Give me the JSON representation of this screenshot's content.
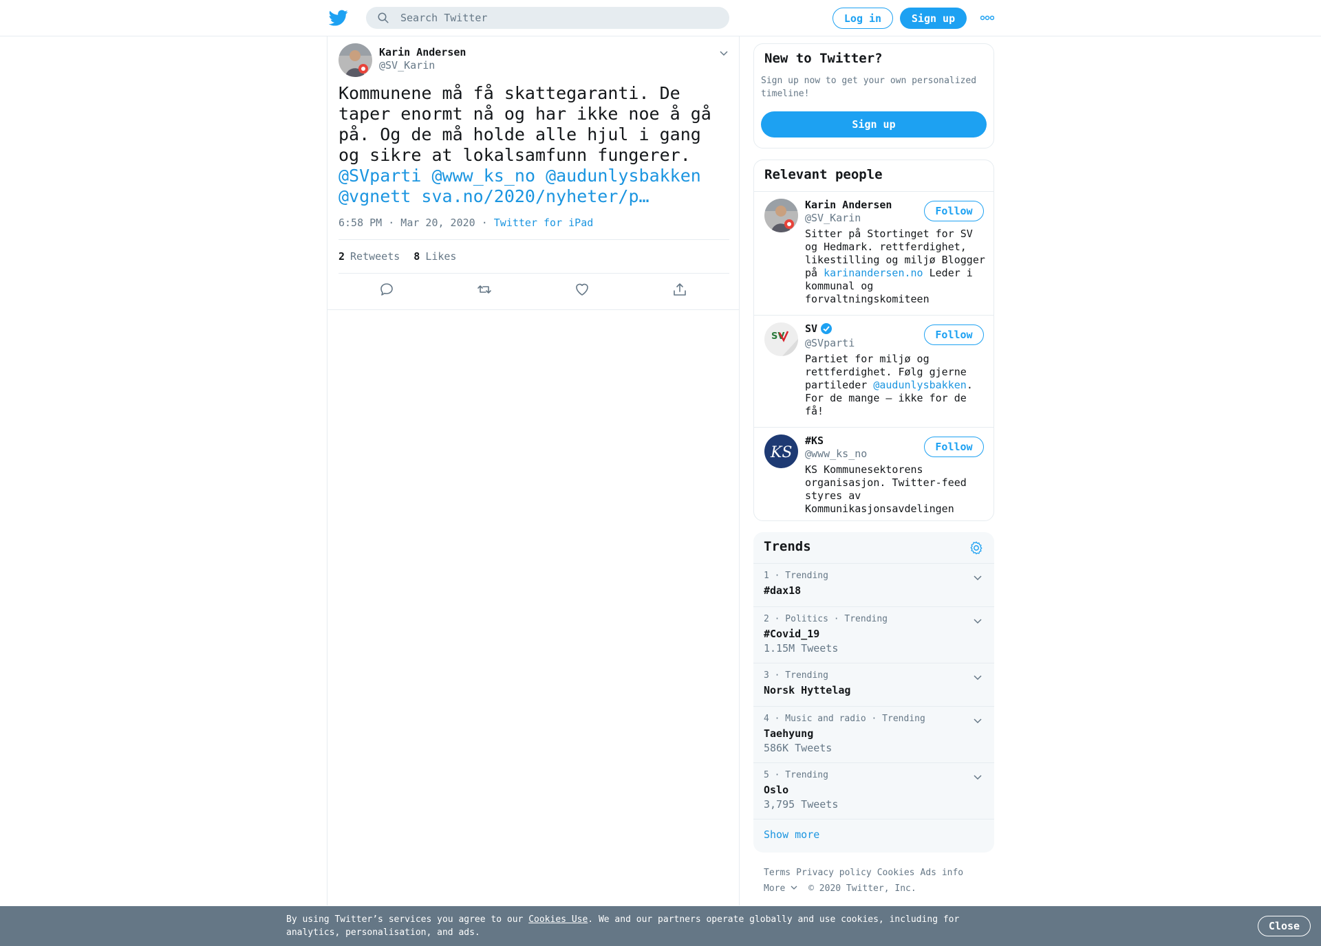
{
  "header": {
    "search_placeholder": "Search Twitter",
    "login_label": "Log in",
    "signup_label": "Sign up"
  },
  "tweet": {
    "author_name": "Karin Andersen",
    "author_handle": "@SV_Karin",
    "text_plain": "Kommunene må få skattegaranti. De taper enormt nå og har ikke noe å gå på. Og de må holde alle hjul i gang og sikre at lokalsamfunn fungerer. ",
    "mention_1": "@SVparti",
    "mention_2": "@www_ks_no",
    "mention_3": "@audunlysbakken",
    "mention_4": "@vgnett",
    "link": "sva.no/2020/nyheter/p…",
    "time": "6:58 PM · Mar 20, 2020",
    "sep": "·",
    "source": "Twitter for iPad",
    "retweets_count": "2",
    "retweets_label": "Retweets",
    "likes_count": "8",
    "likes_label": "Likes"
  },
  "new_to_twitter": {
    "title": "New to Twitter?",
    "subtitle": "Sign up now to get your own personalized timeline!",
    "button": "Sign up"
  },
  "relevant_people": {
    "title": "Relevant people",
    "people": [
      {
        "name": "Karin Andersen",
        "handle": "@SV_Karin",
        "follow": "Follow",
        "bio_before": "Sitter på Stortinget for SV og Hedmark. rettferdighet, likestilling og miljø Blogger på ",
        "bio_link": "karinandersen.no",
        "bio_after": " Leder i kommunal og forvaltningskomiteen"
      },
      {
        "name": "SV",
        "handle": "@SVparti",
        "follow": "Follow",
        "bio_before": "Partiet for miljø og rettferdighet. Følg gjerne partileder ",
        "bio_link": "@audunlysbakken",
        "bio_after": ". For de mange — ikke for de få!",
        "avatar_text": "SV"
      },
      {
        "name": "#KS",
        "handle": "@www_ks_no",
        "follow": "Follow",
        "bio_before": "KS Kommunesektorens organisasjon. Twitter-feed styres av Kommunikasjonsavdelingen",
        "bio_link": "",
        "bio_after": "",
        "avatar_text": "KS"
      }
    ]
  },
  "trends": {
    "title": "Trends",
    "items": [
      {
        "meta": "1 · Trending",
        "name": "#dax18",
        "count": ""
      },
      {
        "meta": "2 · Politics · Trending",
        "name": "#Covid_19",
        "count": "1.15M Tweets"
      },
      {
        "meta": "3 · Trending",
        "name": "Norsk Hyttelag",
        "count": ""
      },
      {
        "meta": "4 · Music and radio · Trending",
        "name": "Taehyung",
        "count": "586K Tweets"
      },
      {
        "meta": "5 · Trending",
        "name": "Oslo",
        "count": "3,795 Tweets"
      }
    ],
    "show_more": "Show more"
  },
  "footer": {
    "terms": "Terms",
    "privacy": "Privacy policy",
    "cookies": "Cookies",
    "ads": "Ads info",
    "more": "More",
    "copyright": "© 2020 Twitter, Inc."
  },
  "cookie_banner": {
    "text_before": "By using Twitter’s services you agree to our ",
    "link": "Cookies Use",
    "text_after": ". We and our partners operate globally and use cookies, including for analytics, personalisation, and ads.",
    "close": "Close"
  },
  "colors": {
    "brand": "#1da1f2",
    "link": "#1b95e0",
    "muted": "#657786",
    "banner": "#657786"
  }
}
